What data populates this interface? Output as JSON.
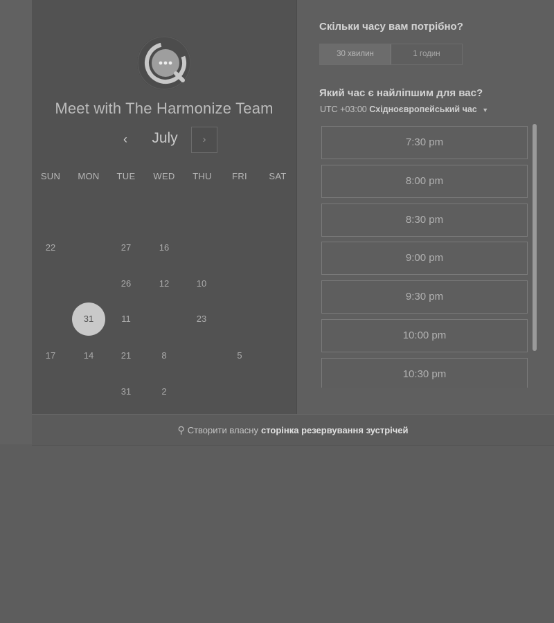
{
  "header": {
    "title": "Meet with The Harmonize Team"
  },
  "calendar": {
    "month": "July",
    "prev_icon": "‹",
    "next_icon": "›",
    "weekdays": [
      "SUN",
      "MON",
      "TUE",
      "WED",
      "THU",
      "FRI",
      "SAT"
    ],
    "weeks": [
      [
        "",
        "",
        "",
        "",
        "",
        "",
        ""
      ],
      [
        "22",
        "",
        "27",
        "16",
        "",
        "",
        ""
      ],
      [
        "",
        "",
        "26",
        "12",
        "10",
        "",
        ""
      ],
      [
        "",
        "31",
        "11",
        "",
        "23",
        "",
        ""
      ],
      [
        "17",
        "14",
        "21",
        "8",
        "",
        "5",
        ""
      ],
      [
        "",
        "",
        "31",
        "2",
        "",
        "",
        ""
      ]
    ],
    "selected_day": "31"
  },
  "booking": {
    "duration_question": "Скільки часу вам потрібно?",
    "durations": [
      "30 хвилин",
      "1 годин"
    ],
    "active_duration": "30 хвилин",
    "time_question": "Який час є найліпшим для вас?",
    "timezone_offset": "UTC +03:00",
    "timezone_name": "Східноєвропейський час",
    "slots": [
      "7:30 pm",
      "8:00 pm",
      "8:30 pm",
      "9:00 pm",
      "9:30 pm",
      "10:00 pm",
      "10:30 pm"
    ]
  },
  "footer": {
    "text": "Створити власну",
    "link": "сторінка резервування зустрічей"
  },
  "colors": {
    "background": "#5d5d5d",
    "left_panel": "#525252",
    "selected_day": "#c9c9c9"
  }
}
